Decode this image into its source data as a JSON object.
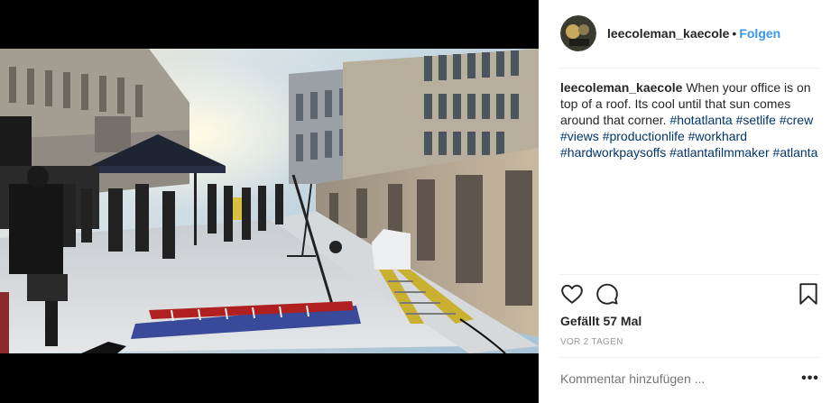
{
  "post": {
    "username": "leecoleman_kaecole",
    "separator": "•",
    "follow_label": "Folgen",
    "caption": {
      "username": "leecoleman_kaecole",
      "text": "When your office is on top of a roof. Its cool until that sun comes around that corner.",
      "hashtags": [
        "#hotatlanta",
        "#setlife",
        "#crew",
        "#views",
        "#productionlife",
        "#workhard",
        "#hardworkpaysoffs",
        "#atlantafilmmaker",
        "#atlanta"
      ]
    },
    "likes_text": "Gefällt 57 Mal",
    "time_text": "VOR 2 TAGEN",
    "comment_placeholder": "Kommentar hinzufügen ...",
    "more_label": "•••"
  },
  "icons": {
    "like": "heart-icon",
    "comment": "comment-icon",
    "save": "bookmark-icon",
    "more": "more-options-icon"
  },
  "colors": {
    "follow": "#3897f0",
    "hashtag": "#003569",
    "text": "#262626",
    "muted": "#999999"
  }
}
